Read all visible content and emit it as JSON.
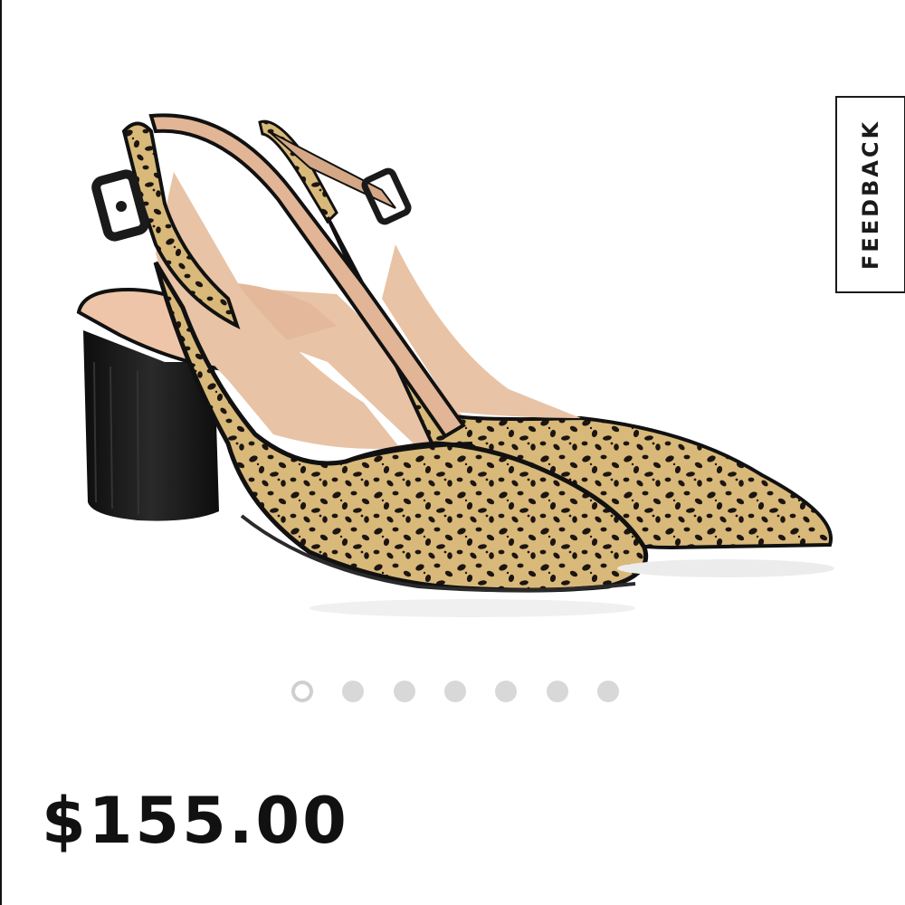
{
  "product": {
    "image_alt": "Leopard print slingback pointed-toe block heel pumps",
    "price": "$155.00"
  },
  "feedback": {
    "label": "FEEDBACK"
  },
  "carousel": {
    "total": 7,
    "active_index": 0
  },
  "colors": {
    "leopard_base": "#d9b97a",
    "spots": "#1c1511",
    "lining": "#e8c3a6",
    "heel": "#171717",
    "dot": "#d8d8d8"
  }
}
